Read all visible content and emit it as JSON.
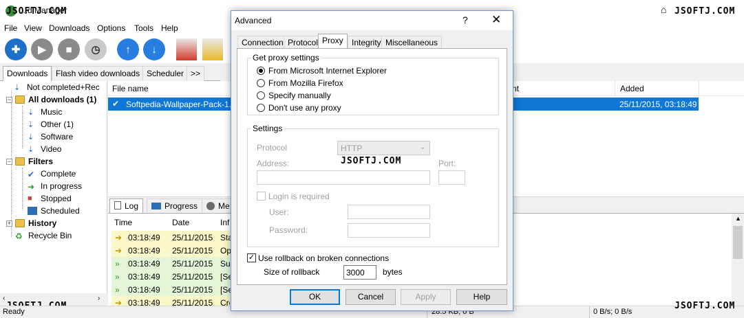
{
  "app": {
    "title": "...d Manager",
    "watermark": "JSOFTJ.COM"
  },
  "menu": [
    "File",
    "View",
    "Downloads",
    "Options",
    "Tools",
    "Help"
  ],
  "main_tabs": [
    "Downloads",
    "Flash video downloads",
    "Scheduler",
    ">>"
  ],
  "tree": {
    "not_completed": "Not completed+Rec",
    "all_downloads": "All downloads (1)",
    "music": "Music",
    "other": "Other (1)",
    "software": "Software",
    "video": "Video",
    "filters": "Filters",
    "complete": "Complete",
    "in_progress": "In progress",
    "stopped": "Stopped",
    "scheduled": "Scheduled",
    "history": "History",
    "recycle_bin": "Recycle Bin"
  },
  "files": {
    "col_file_name": "File name",
    "col_partial": "nt",
    "col_added": "Added",
    "row": {
      "name": "Softpedia-Wallpaper-Pack-1.",
      "added": "25/11/2015, 03:18:49"
    }
  },
  "bottom_tabs": [
    "Log",
    "Progress",
    "Me"
  ],
  "log": {
    "columns": [
      "Time",
      "Date",
      "Inf"
    ],
    "rows": [
      {
        "time": "03:18:49",
        "date": "25/11/2015",
        "info": "Sta"
      },
      {
        "time": "03:18:49",
        "date": "25/11/2015",
        "info": "Op"
      },
      {
        "time": "03:18:49",
        "date": "25/11/2015",
        "info": "Suc"
      },
      {
        "time": "03:18:49",
        "date": "25/11/2015",
        "info": "[Se"
      },
      {
        "time": "03:18:49",
        "date": "25/11/2015",
        "info": "[Se"
      },
      {
        "time": "03:18:49",
        "date": "25/11/2015",
        "info": "Cre"
      }
    ]
  },
  "status": {
    "ready": "Ready",
    "size": "28.5 KB; 0 B",
    "speed": "0 B/s; 0 B/s"
  },
  "dialog": {
    "title": "Advanced",
    "help": "?",
    "close": "✕",
    "tabs": [
      "Connection",
      "Protocol",
      "Proxy",
      "Integrity",
      "Miscellaneous"
    ],
    "active_tab": "Proxy",
    "proxy_group": "Get proxy settings",
    "options": [
      "From Microsoft Internet Explorer",
      "From Mozilla Firefox",
      "Specify manually",
      "Don't use any proxy"
    ],
    "selected_option": "From Microsoft Internet Explorer",
    "settings_group": "Settings",
    "protocol_label": "Protocol",
    "protocol_value": "HTTP",
    "address_label": "Address:",
    "port_label": "Port:",
    "login_required": "Login is required",
    "user_label": "User:",
    "password_label": "Password:",
    "rollback_label": "Use rollback on broken connections",
    "rollback_checked": true,
    "rollback_size_label": "Size of rollback",
    "rollback_size": "3000",
    "rollback_unit": "bytes",
    "buttons": {
      "ok": "OK",
      "cancel": "Cancel",
      "apply": "Apply",
      "help": "Help"
    }
  },
  "colors": {
    "selection": "#0f78d7",
    "log_row_yellow": "#fbf7c8",
    "log_row_green": "#e4f5d8",
    "accent": "#0078d7"
  }
}
